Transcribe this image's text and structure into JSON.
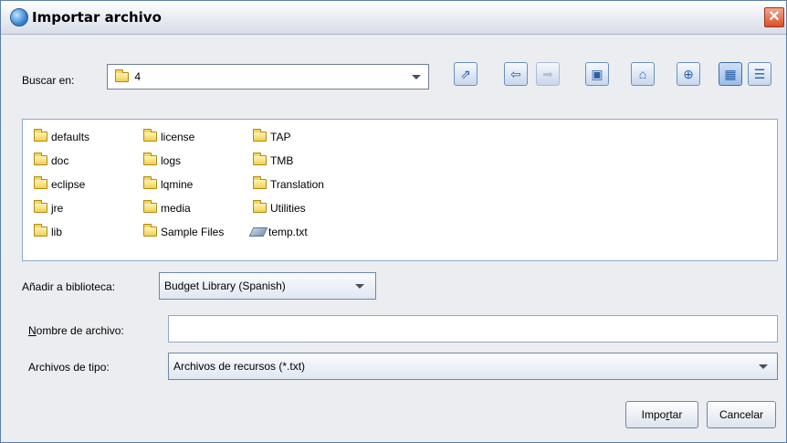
{
  "window": {
    "title": "Importar archivo",
    "close_glyph": "✕"
  },
  "lookin": {
    "label": "Buscar en:",
    "value": "4"
  },
  "toolbar": {
    "buttons": [
      {
        "name": "up-one-level-icon",
        "glyph": "⇗"
      },
      {
        "name": "back-arrow-icon",
        "glyph": "⇦"
      },
      {
        "name": "forward-arrow-icon",
        "glyph": "➡"
      },
      {
        "name": "library-icon",
        "glyph": "▣"
      },
      {
        "name": "home-icon",
        "glyph": "⌂"
      },
      {
        "name": "new-folder-icon",
        "glyph": "⊕"
      },
      {
        "name": "list-view-icon",
        "glyph": "▦"
      },
      {
        "name": "details-view-icon",
        "glyph": "☰"
      }
    ]
  },
  "files": {
    "col1": [
      "defaults",
      "doc",
      "eclipse",
      "jre",
      "lib"
    ],
    "col2": [
      "license",
      "logs",
      "lqmine",
      "media",
      "Sample Files"
    ],
    "col3": [
      "TAP",
      "TMB",
      "Translation",
      "Utilities"
    ],
    "text_file": "temp.txt"
  },
  "library": {
    "label": "Añadir a biblioteca:",
    "value": "Budget Library (Spanish)"
  },
  "filename": {
    "label_u": "N",
    "label_rest": "ombre de archivo:",
    "value": ""
  },
  "filetype": {
    "label": "Archivos de tipo:",
    "value": "Archivos de recursos (*.txt)"
  },
  "buttons": {
    "import_a": "Impo",
    "import_u": "r",
    "import_b": "tar",
    "cancel": "Cancelar"
  }
}
